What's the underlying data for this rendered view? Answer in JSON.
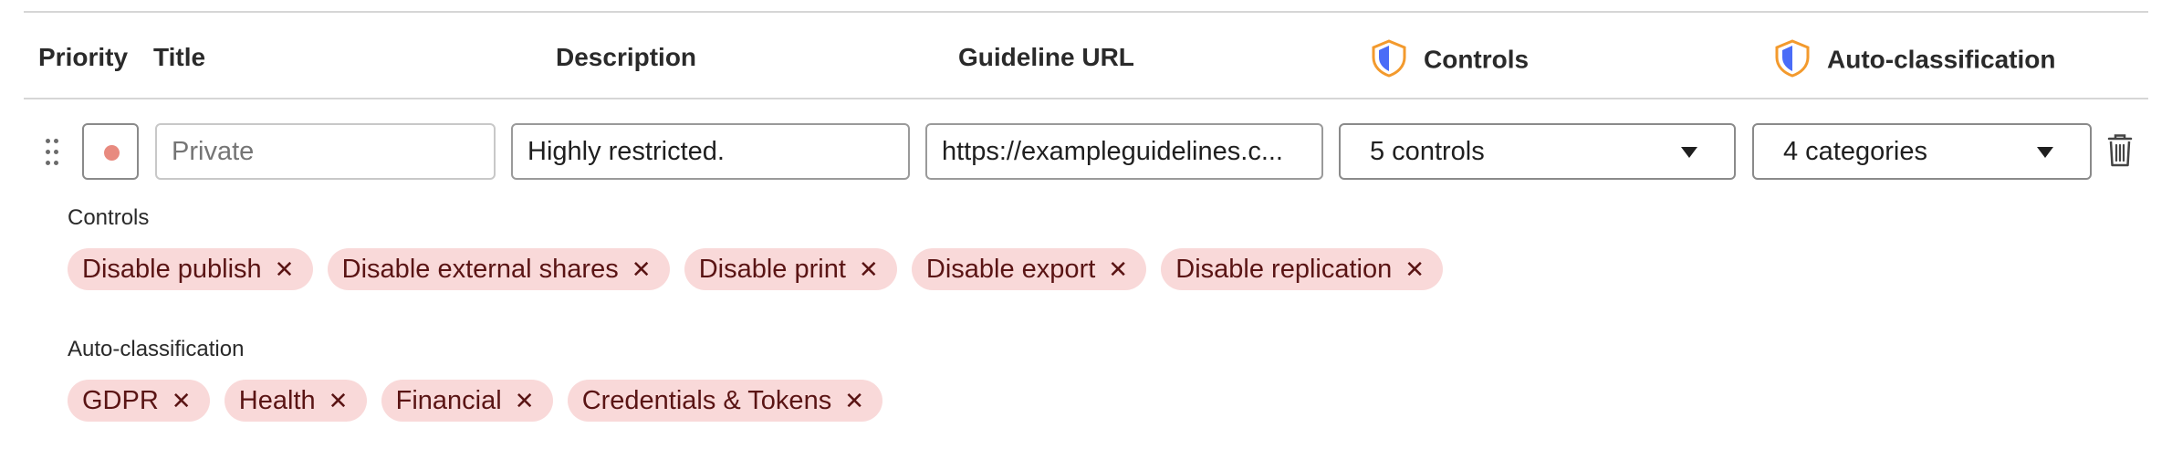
{
  "header": {
    "priority": "Priority",
    "title": "Title",
    "description": "Description",
    "guideline_url": "Guideline URL",
    "controls": "Controls",
    "auto_classification": "Auto-classification",
    "shield_colors": {
      "left": "#4a6cf7",
      "right": "#f39a2d",
      "outline": "#f39a2d"
    }
  },
  "row": {
    "priority_color": "#e88a7f",
    "title_placeholder": "Private",
    "title_value": "",
    "description_value": "Highly restricted.",
    "url_value": "https://exampleguidelines.c...",
    "controls_select": "5 controls",
    "auto_select": "4 categories"
  },
  "controls_section": {
    "label": "Controls",
    "chips": [
      "Disable publish",
      "Disable external shares",
      "Disable print",
      "Disable export",
      "Disable replication"
    ]
  },
  "auto_section": {
    "label": "Auto-classification",
    "chips": [
      "GDPR",
      "Health",
      "Financial",
      "Credentials & Tokens"
    ]
  },
  "colors": {
    "chip_bg": "#f9d9d9",
    "chip_text": "#5a1414",
    "divider": "#d6d6d6"
  }
}
